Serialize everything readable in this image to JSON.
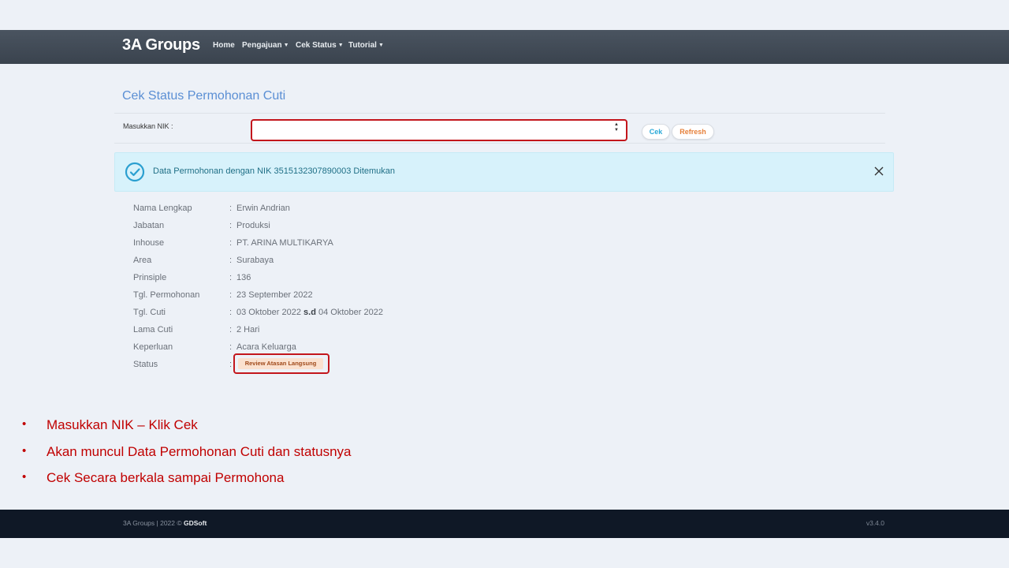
{
  "navbar": {
    "brand": "3A Groups",
    "items": [
      {
        "label": "Home",
        "dropdown": false
      },
      {
        "label": "Pengajuan",
        "dropdown": true
      },
      {
        "label": "Cek Status",
        "dropdown": true
      },
      {
        "label": "Tutorial",
        "dropdown": true
      }
    ]
  },
  "page": {
    "title": "Cek Status Permohonan Cuti",
    "nik_label": "Masukkan NIK :",
    "nik_value": "",
    "cek_button": "Cek",
    "refresh_button": "Refresh"
  },
  "alert": {
    "message": "Data Permohonan dengan NIK 3515132307890003 Ditemukan",
    "icon": "check-circle-icon"
  },
  "details": {
    "separator": ":",
    "rows": [
      {
        "label": "Nama Lengkap",
        "value": "Erwin Andrian"
      },
      {
        "label": "Jabatan",
        "value": "Produksi"
      },
      {
        "label": "Inhouse",
        "value": "PT. ARINA MULTIKARYA"
      },
      {
        "label": "Area",
        "value": "Surabaya"
      },
      {
        "label": "Prinsiple",
        "value": "136"
      },
      {
        "label": "Tgl. Permohonan",
        "value": "23 September 2022"
      }
    ],
    "tgl_cuti": {
      "label": "Tgl. Cuti",
      "start": "03 Oktober 2022",
      "connector": "s.d",
      "end": "04 Oktober 2022"
    },
    "rows2": [
      {
        "label": "Lama Cuti",
        "value": "2 Hari"
      },
      {
        "label": "Keperluan",
        "value": "Acara Keluarga"
      }
    ],
    "status": {
      "label": "Status",
      "value": "Review Atasan Langsung"
    }
  },
  "instructions": {
    "bullet": "•",
    "items": [
      "Masukkan NIK – Klik Cek",
      "Akan muncul Data Permohonan Cuti dan statusnya",
      "Cek Secara berkala sampai Permohona"
    ]
  },
  "footer": {
    "text": "3A Groups | 2022 ©",
    "brand": "GDSoft",
    "version": "v3.4.0"
  },
  "colors": {
    "accent": "#5b8fd4",
    "highlight": "#c3161c",
    "instruction": "#c00000",
    "alert_bg": "#d7f2fb"
  }
}
